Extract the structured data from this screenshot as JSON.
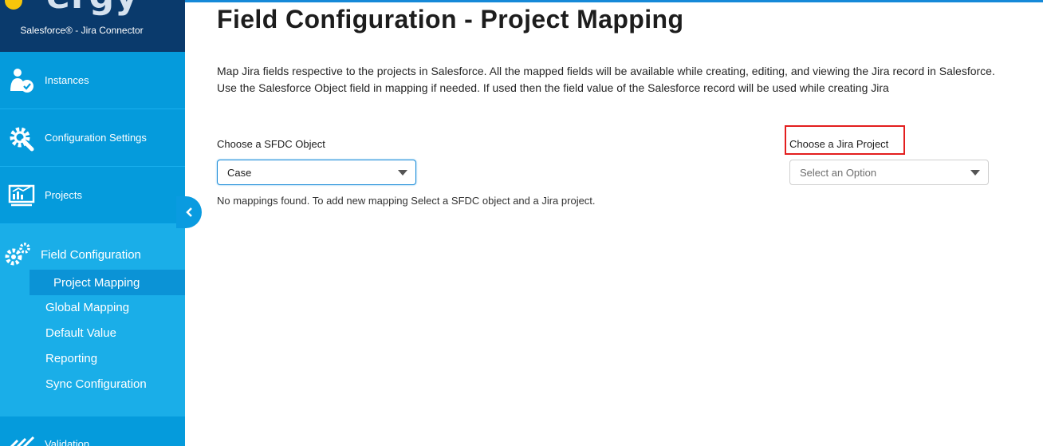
{
  "sidebar": {
    "brand_logo": "ergy",
    "brand_subtitle": "Salesforce® - Jira Connector",
    "items": [
      {
        "label": "Instances",
        "icon": "user-check-icon"
      },
      {
        "label": "Configuration Settings",
        "icon": "gear-wrench-icon"
      },
      {
        "label": "Projects",
        "icon": "presentation-chart-icon"
      }
    ],
    "field_configuration": {
      "label": "Field Configuration",
      "icon": "gears-icon",
      "sub_items": [
        {
          "label": "Project Mapping",
          "active": true
        },
        {
          "label": "Global Mapping"
        },
        {
          "label": "Default Value"
        },
        {
          "label": "Reporting"
        },
        {
          "label": "Sync Configuration"
        }
      ]
    },
    "bottom_item": {
      "label": "Validation",
      "icon": "checkmarks-icon"
    },
    "collapse_icon": "chevron-left-icon"
  },
  "main": {
    "title": "Field Configuration - Project Mapping",
    "description": "Map Jira fields respective to the projects in Salesforce. All the mapped fields will be available while creating, editing, and viewing the Jira record in Salesforce. Use the Salesforce Object field in mapping if needed. If used then the field value of the Salesforce record will be used while creating Jira",
    "sfdc_label": "Choose a SFDC Object",
    "sfdc_value": "Case",
    "jira_label": "Choose a Jira Project",
    "jira_placeholder": "Select an Option",
    "no_mappings": "No mappings found. To add new mapping Select a SFDC object and a Jira project."
  },
  "colors": {
    "sidebar": "#059bdc",
    "brand": "#0a3a6c",
    "highlight_box": "#e31e1e",
    "focus_border": "#1b8cd8"
  }
}
